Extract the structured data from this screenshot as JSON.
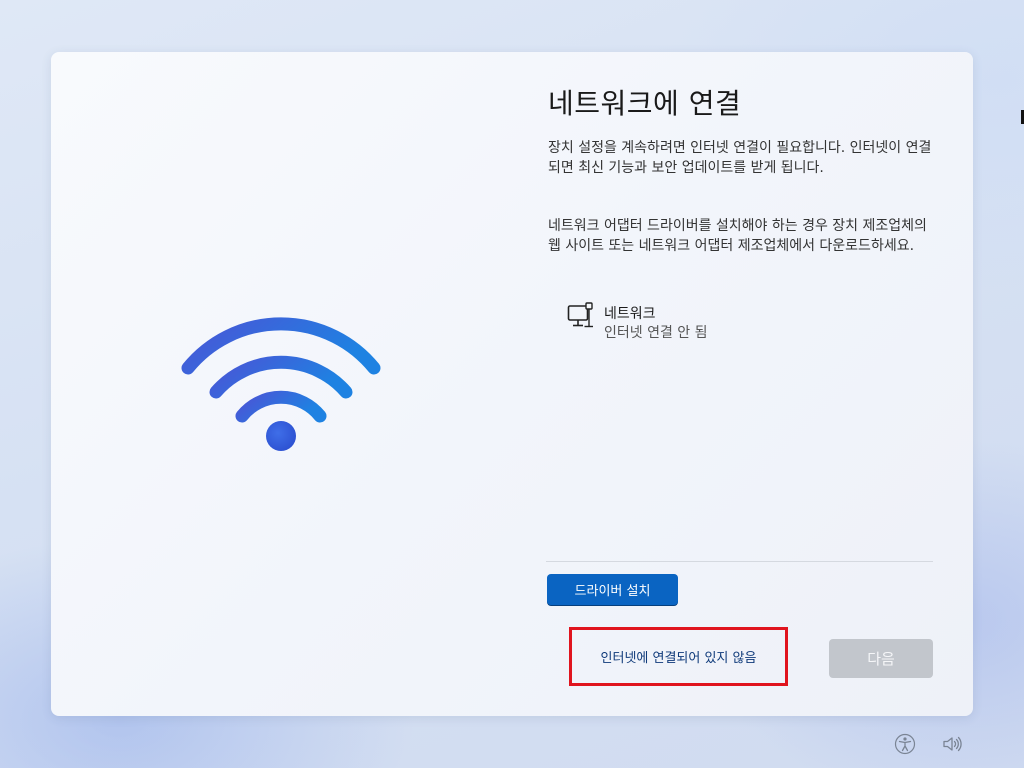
{
  "page": {
    "title": "네트워크에 연결",
    "description_1": "장치 설정을 계속하려면 인터넷 연결이 필요합니다. 인터넷이 연결되면 최신 기능과 보안 업데이트를 받게 됩니다.",
    "description_2": "네트워크 어댑터 드라이버를 설치해야 하는 경우 장치 제조업체의 웹 사이트 또는 네트워크 어댑터 제조업체에서 다운로드하세요."
  },
  "network": {
    "name": "네트워크",
    "status": "인터넷 연결 안 됨",
    "icon": "wired-network-icon"
  },
  "actions": {
    "install_driver_label": "드라이버 설치",
    "no_internet_label": "인터넷에 연결되어 있지 않음",
    "next_label": "다음"
  },
  "taskbar": {
    "icons": [
      "accessibility-icon",
      "volume-icon"
    ]
  },
  "colors": {
    "accent": "#0a64c2",
    "highlight_border": "#e0141e",
    "wifi_gradient_start": "#3b5bdb",
    "wifi_gradient_end": "#1e88e5",
    "disabled_button": "#c2c6cc"
  }
}
